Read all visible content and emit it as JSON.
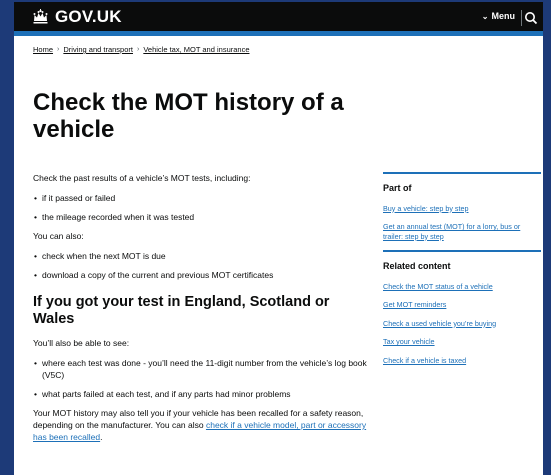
{
  "header": {
    "logo_text": "GOV.UK",
    "menu_label": "Menu"
  },
  "breadcrumb": [
    "Home",
    "Driving and transport",
    "Vehicle tax, MOT and insurance"
  ],
  "page": {
    "title": "Check the MOT history of a vehicle",
    "intro": "Check the past results of a vehicle’s MOT tests, including:",
    "list1": [
      "if it passed or failed",
      "the mileage recorded when it was tested"
    ],
    "also": "You can also:",
    "list2": [
      "check when the next MOT is due",
      "download a copy of the current and previous MOT certificates"
    ],
    "subheading": "If you got your test in England, Scotland or Wales",
    "also_see": "You’ll also be able to see:",
    "list3": [
      "where each test was done - you’ll need the 11-digit number from the vehicle’s log book (V5C)",
      "what parts failed at each test, and if any parts had minor problems"
    ],
    "recall_text": "Your MOT history may also tell you if your vehicle has been recalled for a safety reason, depending on the manufacturer. You can also ",
    "recall_link": "check if a vehicle model, part or accessory has been recalled",
    "recall_end": "."
  },
  "sidebar": {
    "part_of_title": "Part of",
    "part_of_links": [
      "Buy a vehicle: step by step",
      "Get an annual test (MOT) for a lorry, bus or trailer: step by step"
    ],
    "related_title": "Related content",
    "related_links": [
      "Check the MOT status of a vehicle",
      "Get MOT reminders",
      "Check a used vehicle you’re buying",
      "Tax your vehicle",
      "Check if a vehicle is taxed"
    ]
  },
  "colors": {
    "frame": "#1d3a78",
    "header_bg": "#0b0c0c",
    "accent": "#1d70b8"
  }
}
